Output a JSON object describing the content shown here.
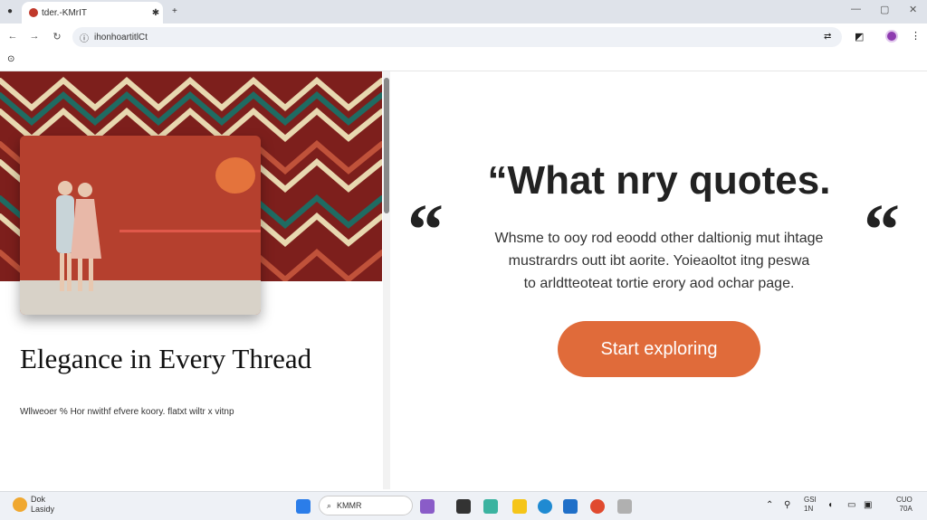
{
  "browser": {
    "tab_title": "tder.-KMrIT",
    "address": "ihonhoartitlCt",
    "new_tab_label": "+",
    "window_controls": [
      "—",
      "▢",
      "✕"
    ]
  },
  "page": {
    "headline": "Elegance in Every Thread",
    "small_text": "Wllweoer % Hor nwithf efvere koory. flatxt wiltr x vitnp",
    "quote_title": "“What nry quotes.",
    "quote_lines": [
      "Whsme to ooy rod eoodd other daltionig mut ihtage",
      "mustrardrs outt ibt aorite. Yoieaoltot itng peswa",
      "to arldtteoteat tortie erory aod ochar page."
    ],
    "quote_open_mark": "“",
    "quote_close_mark": "“",
    "cta_label": "Start exploring"
  },
  "taskbar": {
    "weather_temp": "Dok",
    "weather_desc": "Lasidy",
    "search_text": "KMMR",
    "tray_1_top": "GSI",
    "tray_1_bottom": "1N",
    "tray_2_top": "CUO",
    "tray_2_bottom": "70A"
  },
  "colors": {
    "accent": "#e06b3a",
    "knit_base": "#7d1f1c",
    "knit_teal": "#1f6b62",
    "knit_cream": "#e8d8b0"
  }
}
